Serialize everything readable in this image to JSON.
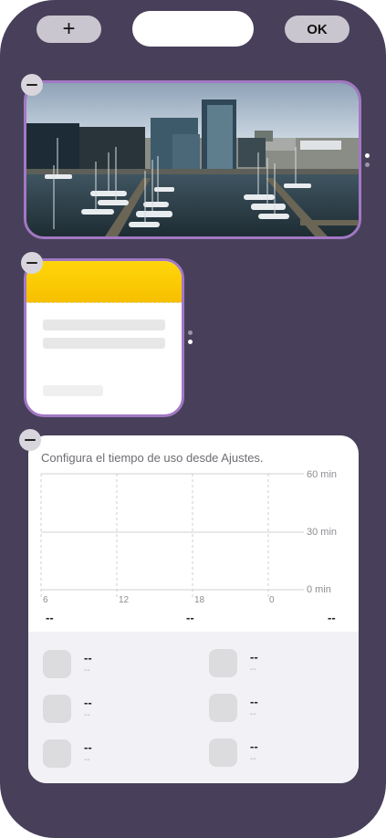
{
  "top_bar": {
    "add_label": "+",
    "done_label": "OK"
  },
  "widgets": {
    "photo": {
      "remove_icon": "minus-circle-icon",
      "page_dots": 2
    },
    "notes": {
      "remove_icon": "minus-circle-icon",
      "page_dots": 2
    },
    "screen_time": {
      "remove_icon": "minus-circle-icon",
      "caption": "Configura el tiempo de uso desde Ajustes.",
      "y_ticks": [
        "60 min",
        "30 min",
        "0 min"
      ],
      "x_ticks": [
        "6",
        "12",
        "18",
        "0"
      ],
      "summary": [
        "--",
        "--",
        "--"
      ],
      "apps": [
        {
          "name": "--",
          "time": "--"
        },
        {
          "name": "--",
          "time": "--"
        },
        {
          "name": "--",
          "time": "--"
        },
        {
          "name": "--",
          "time": "--"
        },
        {
          "name": "--",
          "time": "--"
        },
        {
          "name": "--",
          "time": "--"
        }
      ]
    }
  },
  "colors": {
    "background": "#48405a",
    "selection_border": "#a278c4",
    "notes_header": "#ffd60a",
    "control_gray": "#c9c6cf"
  }
}
